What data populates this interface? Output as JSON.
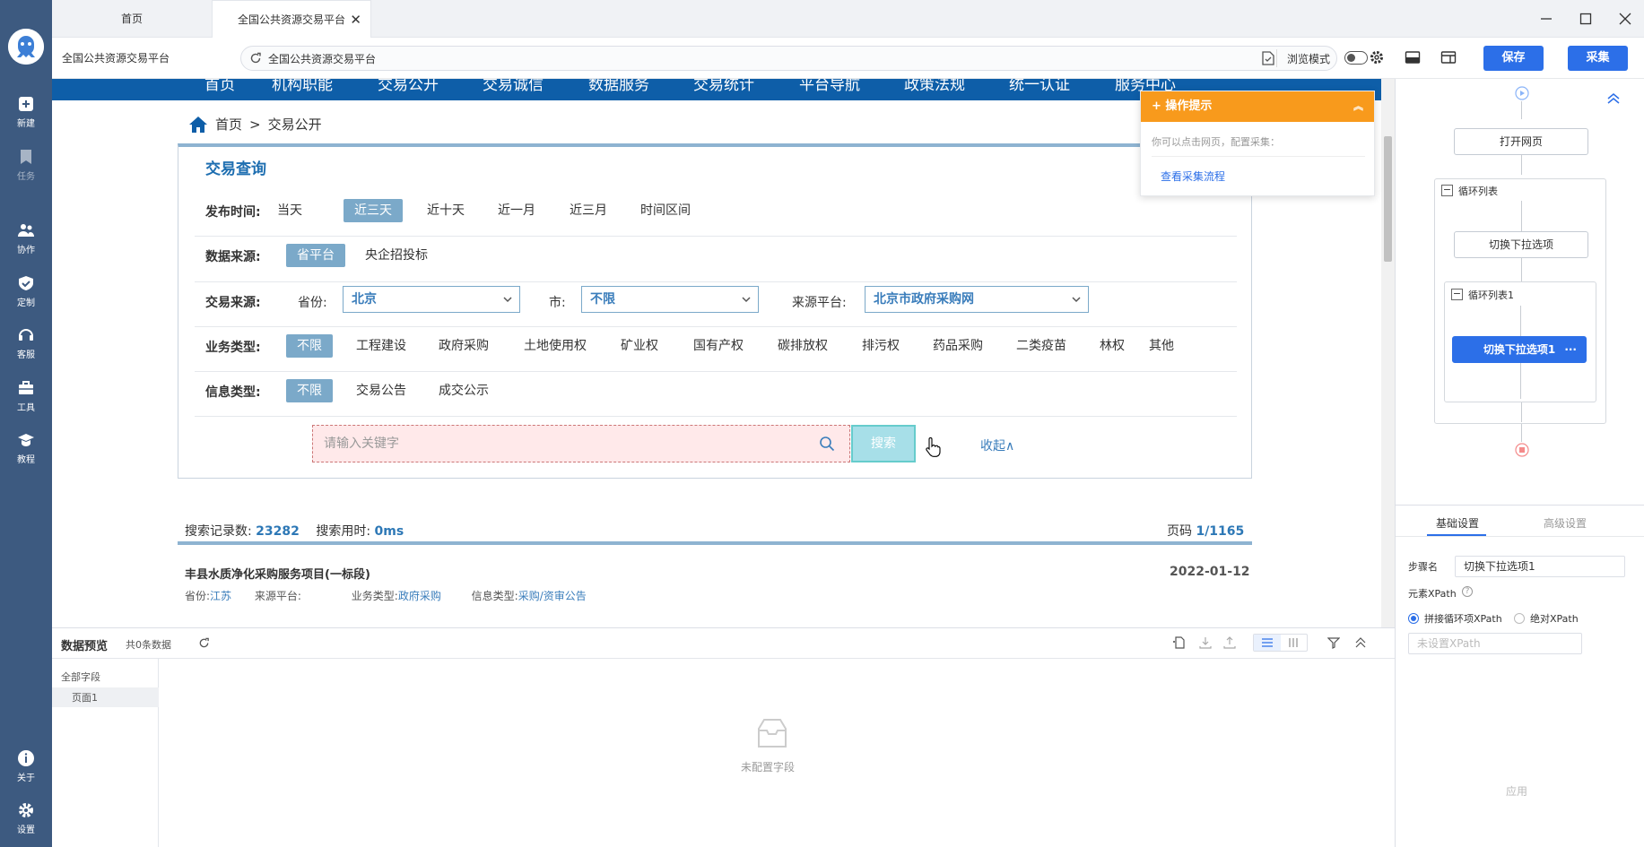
{
  "sidebar": {
    "items": [
      {
        "label": "新建",
        "icon": "plus-square-icon"
      },
      {
        "label": "任务",
        "icon": "bookmark-icon"
      },
      {
        "label": "协作",
        "icon": "users-icon"
      },
      {
        "label": "定制",
        "icon": "check-shield-icon"
      },
      {
        "label": "客服",
        "icon": "headset-icon"
      },
      {
        "label": "工具",
        "icon": "toolbox-icon"
      },
      {
        "label": "教程",
        "icon": "graduation-cap-icon"
      }
    ],
    "bottom": [
      {
        "label": "关于",
        "icon": "info-icon"
      },
      {
        "label": "设置",
        "icon": "gear-icon"
      }
    ]
  },
  "tabs": [
    {
      "label": "首页",
      "active": false
    },
    {
      "label": "全国公共资源交易平台",
      "active": true
    }
  ],
  "address_bar": {
    "page_title": "全国公共资源交易平台",
    "url": "全国公共资源交易平台",
    "browse_mode_label": "浏览模式",
    "save_label": "保存",
    "collect_label": "采集"
  },
  "webpage": {
    "nav_items": [
      "首页",
      "机构职能",
      "交易公开",
      "交易诚信",
      "数据服务",
      "交易统计",
      "平台导航",
      "政策法规",
      "统一认证",
      "服务中心"
    ],
    "breadcrumb": {
      "home": "首页",
      "sep": ">",
      "current": "交易公开"
    },
    "query_title": "交易查询",
    "rows": {
      "publish_time": {
        "label": "发布时间:",
        "options": [
          "当天",
          "近三天",
          "近十天",
          "近一月",
          "近三月",
          "时间区间"
        ],
        "selected": 1
      },
      "data_source": {
        "label": "数据来源:",
        "options": [
          "省平台",
          "央企招投标"
        ],
        "selected": 0
      },
      "trade_source": {
        "label": "交易来源:",
        "province_label": "省份:",
        "province_value": "北京",
        "city_label": "市:",
        "city_value": "不限",
        "platform_label": "来源平台:",
        "platform_value": "北京市政府采购网"
      },
      "business_type": {
        "label": "业务类型:",
        "options": [
          "不限",
          "工程建设",
          "政府采购",
          "土地使用权",
          "矿业权",
          "国有产权",
          "碳排放权",
          "排污权",
          "药品采购",
          "二类疫苗",
          "林权",
          "其他"
        ],
        "selected": 0
      },
      "info_type": {
        "label": "信息类型:",
        "options": [
          "不限",
          "交易公告",
          "成交公示"
        ],
        "selected": 0
      }
    },
    "keyword_placeholder": "请输入关键字",
    "search_button": "搜索",
    "collapse_label": "收起∧",
    "summary": {
      "records_label": "搜索记录数:",
      "records_value": "23282",
      "time_label": "搜索用时:",
      "time_value": "0ms",
      "page_label": "页码",
      "page_value": "1/1165"
    },
    "result": {
      "title": "丰县水质净化采购服务项目(一标段)",
      "date": "2022-01-12",
      "province_label": "省份:",
      "province_value": "江苏",
      "platform_label": "来源平台:",
      "business_label": "业务类型:",
      "business_value": "政府采购",
      "info_label": "信息类型:",
      "info_value": "采购/资审公告"
    }
  },
  "tip": {
    "title": "操作提示",
    "body": "你可以点击网页，配置采集：",
    "link": "查看采集流程"
  },
  "preview": {
    "title": "数据预览",
    "count": "共0条数据",
    "all_fields": "全部字段",
    "page1": "页面1",
    "empty": "未配置字段"
  },
  "flow": {
    "open_page": "打开网页",
    "loop_list": "循环列表",
    "switch_dropdown": "切换下拉选项",
    "loop_list1": "循环列表1",
    "switch_dropdown1": "切换下拉选项1",
    "more": "···"
  },
  "settings": {
    "tab_basic": "基础设置",
    "tab_advanced": "高级设置",
    "step_name_label": "步骤名",
    "step_name_value": "切换下拉选项1",
    "xpath_label": "元素XPath",
    "radio_concat": "拼接循环项XPath",
    "radio_absolute": "绝对XPath",
    "xpath_placeholder": "未设置XPath",
    "apply": "应用"
  },
  "colors": {
    "sidebar": "#3d5a80",
    "site_nav": "#0e5ea8",
    "accent": "#2c6fe8",
    "selected_option": "#7ba9c9",
    "tip_header": "#f89a1c"
  }
}
